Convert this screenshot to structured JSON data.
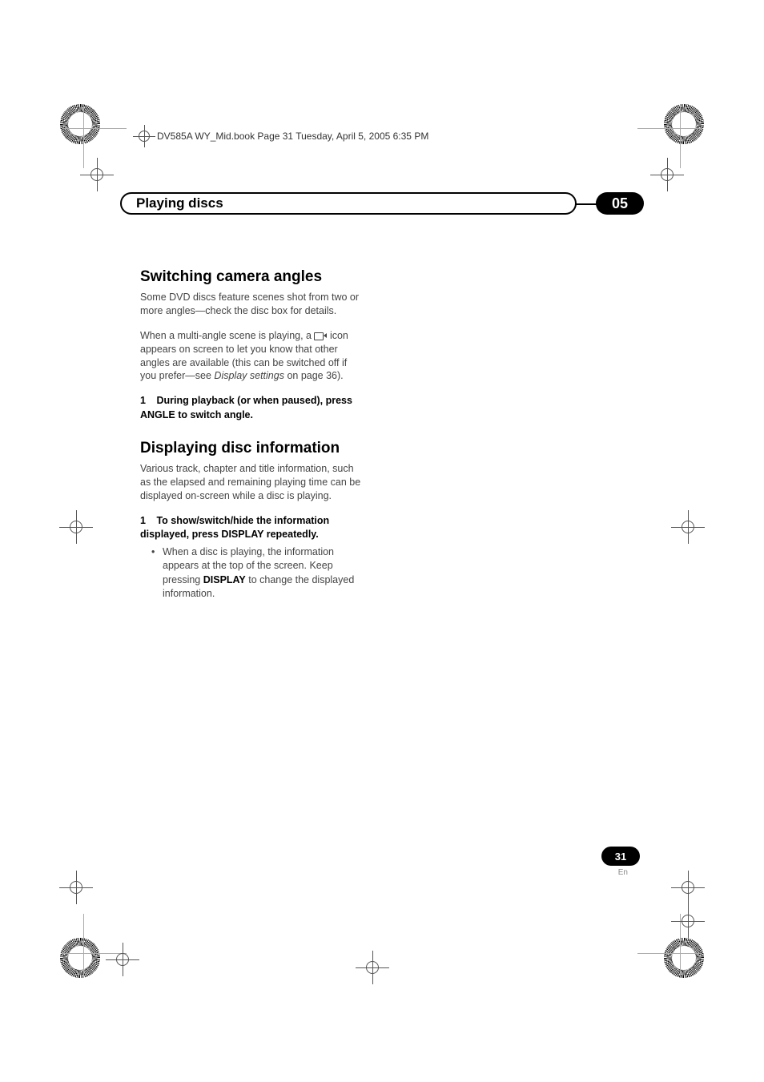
{
  "meta_line": "DV585A WY_Mid.book  Page 31  Tuesday, April 5, 2005  6:35 PM",
  "header": {
    "title": "Playing discs",
    "chapter": "05"
  },
  "section1": {
    "heading": "Switching camera angles",
    "p1": "Some DVD discs feature scenes shot from two or more angles—check the disc box for details.",
    "p2a": "When a multi-angle scene is playing, a ",
    "p2b": " icon appears on screen to let you know that other angles are available (this can be switched off if you prefer—see ",
    "p2_italic": "Display settings",
    "p2c": " on page 36).",
    "step_num": "1",
    "step_text": "During playback (or when paused), press ANGLE to switch angle."
  },
  "section2": {
    "heading": "Displaying disc information",
    "p1": "Various track, chapter and title information, such as the elapsed and remaining playing time can be displayed on-screen while a disc is playing.",
    "step_num": "1",
    "step_text": "To show/switch/hide the information displayed, press DISPLAY repeatedly.",
    "bullet_a": "When a disc is playing, the information appears at the top of the screen. Keep pressing ",
    "bullet_bold": "DISPLAY",
    "bullet_b": " to change the displayed information."
  },
  "page_number": "31",
  "page_lang": "En"
}
